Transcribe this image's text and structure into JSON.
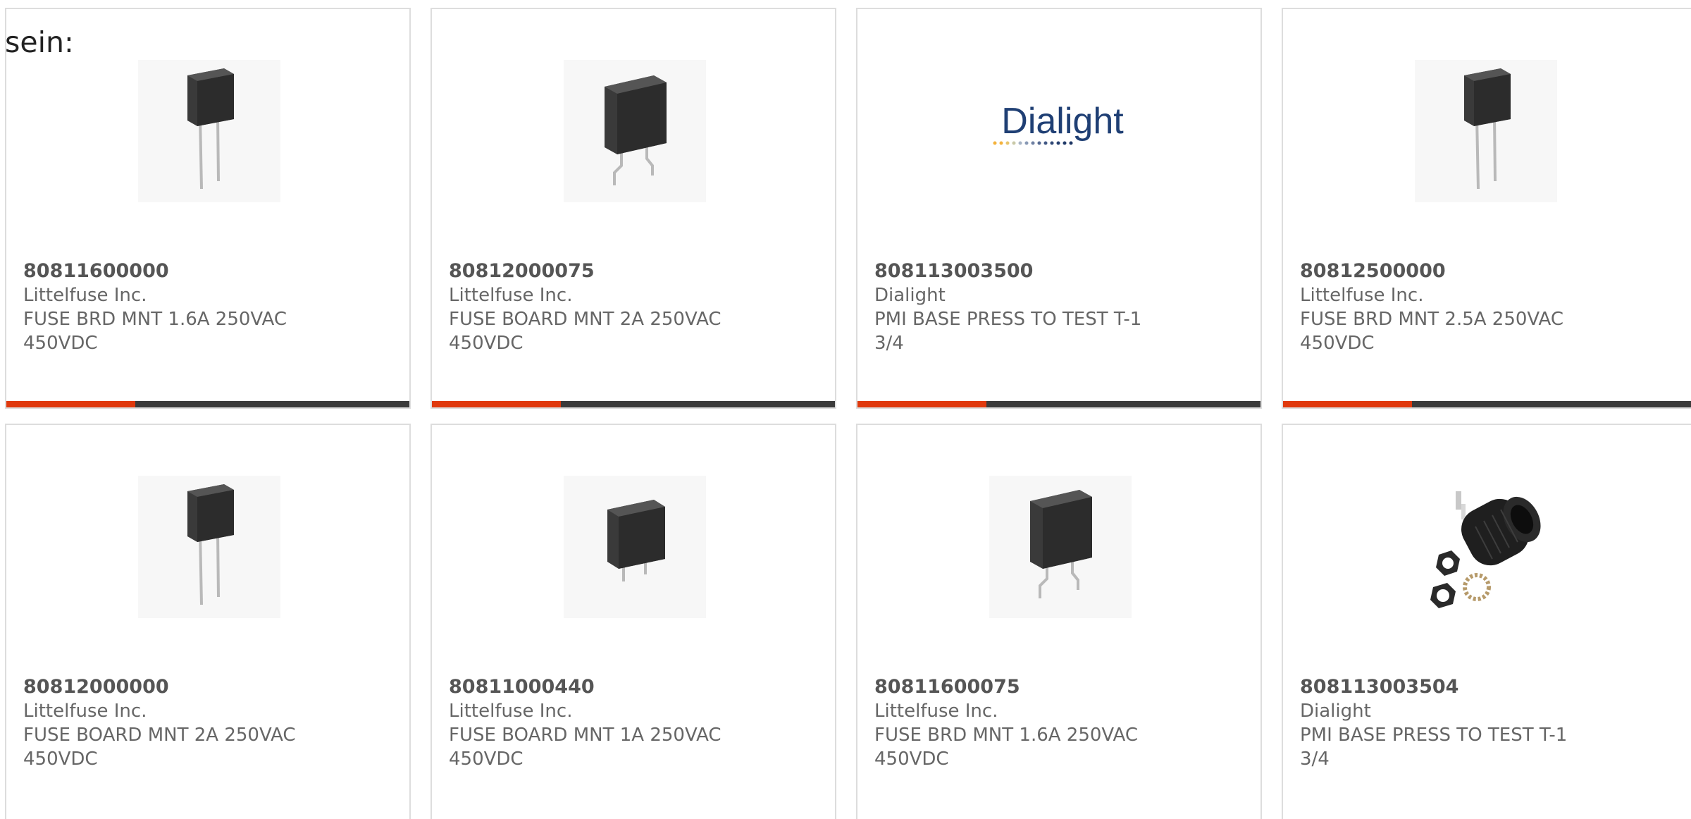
{
  "intro_text": "sein:",
  "colors": {
    "accent": "#e0390d",
    "bar_dark": "#3b3b3b",
    "border": "#dddddd",
    "text": "#666666"
  },
  "products": [
    {
      "part_number": "80811600000",
      "manufacturer": "Littelfuse Inc.",
      "description": "FUSE BRD MNT 1.6A 250VAC\n450VDC",
      "image": "fuse-long-leads-icon",
      "has_bar": true
    },
    {
      "part_number": "80812000075",
      "manufacturer": "Littelfuse Inc.",
      "description": "FUSE BOARD MNT 2A 250VAC\n450VDC",
      "image": "fuse-bent-leads-icon",
      "has_bar": true
    },
    {
      "part_number": "808113003500",
      "manufacturer": "Dialight",
      "description": "PMI BASE PRESS TO TEST T-1\n3/4",
      "image": "dialight-logo",
      "logo_text": "Dialight",
      "has_bar": true
    },
    {
      "part_number": "80812500000",
      "manufacturer": "Littelfuse Inc.",
      "description": "FUSE BRD MNT 2.5A 250VAC\n450VDC",
      "image": "fuse-long-leads-icon",
      "has_bar": true
    },
    {
      "part_number": "80812000000",
      "manufacturer": "Littelfuse Inc.",
      "description": "FUSE BOARD MNT 2A 250VAC\n450VDC",
      "image": "fuse-long-leads-icon",
      "has_bar": false
    },
    {
      "part_number": "80811000440",
      "manufacturer": "Littelfuse Inc.",
      "description": "FUSE BOARD MNT 1A 250VAC\n450VDC",
      "image": "fuse-short-leads-icon",
      "has_bar": false
    },
    {
      "part_number": "80811600075",
      "manufacturer": "Littelfuse Inc.",
      "description": "FUSE BRD MNT 1.6A 250VAC\n450VDC",
      "image": "fuse-bent-leads-icon",
      "has_bar": false
    },
    {
      "part_number": "808113003504",
      "manufacturer": "Dialight",
      "description": "PMI BASE PRESS TO TEST T-1\n3/4",
      "image": "lamp-socket-icon",
      "has_bar": false
    }
  ]
}
